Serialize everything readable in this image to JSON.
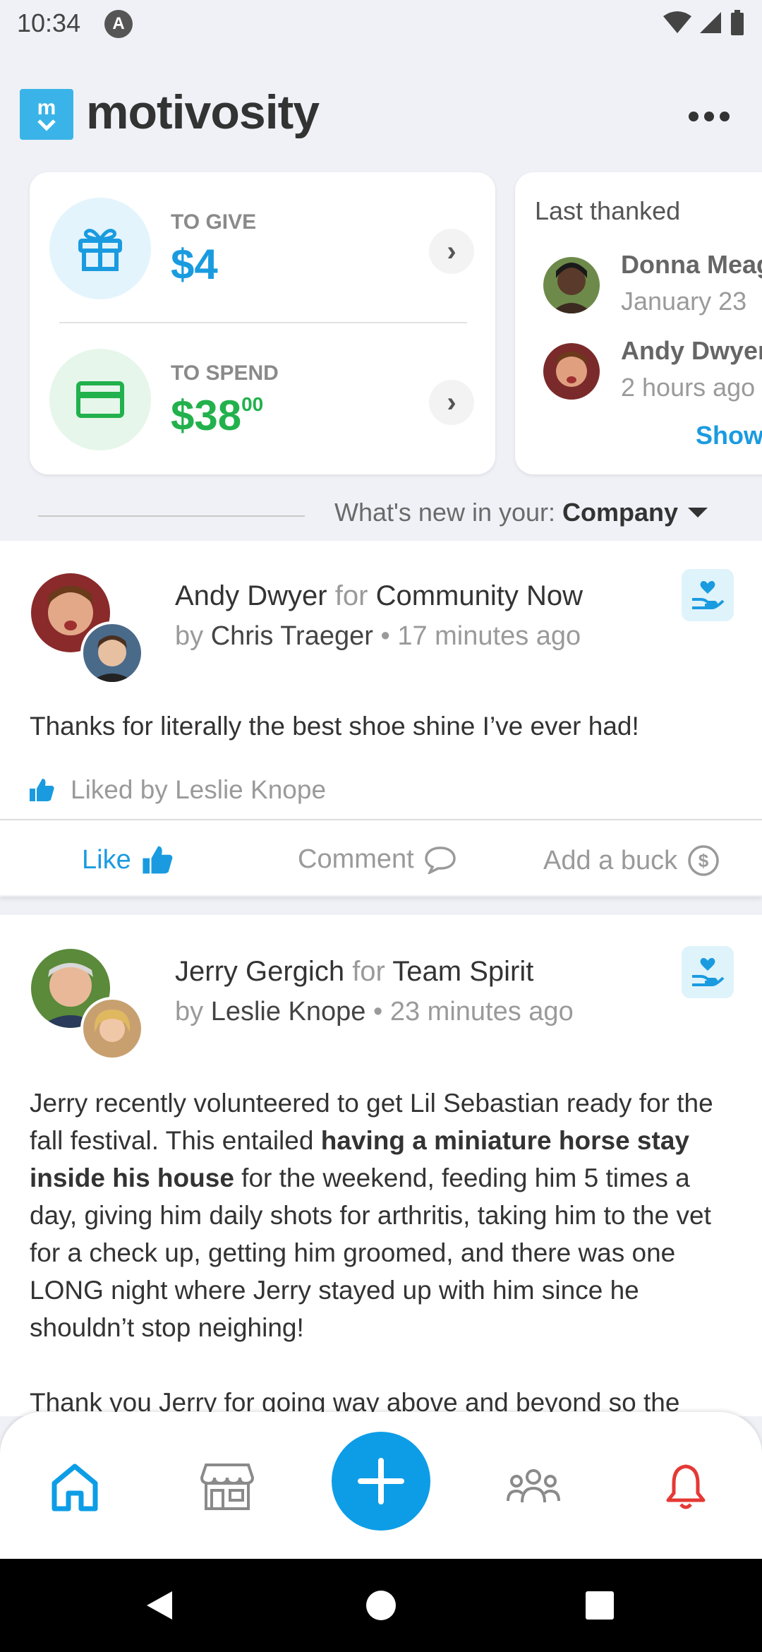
{
  "status": {
    "time": "10:34",
    "app_indicator": "A"
  },
  "app": {
    "logo_mark": "m",
    "logo_text": "motivosity"
  },
  "wallet": {
    "give_label": "TO GIVE",
    "give_amount": "$4",
    "spend_label": "TO SPEND",
    "spend_amount": "$38",
    "spend_cents": "00"
  },
  "last_thanked": {
    "title": "Last thanked",
    "people": [
      {
        "name": "Donna Meagle",
        "date": "January 23"
      },
      {
        "name": "Andy Dwyer",
        "date": "2 hours ago"
      }
    ],
    "show_label": "Show"
  },
  "feed_filter": {
    "prefix": "What's new in your:",
    "value": "Company"
  },
  "posts": [
    {
      "recipient": "Andy Dwyer",
      "for_word": "for",
      "value": "Community Now",
      "by_word": "by",
      "author": "Chris Traeger",
      "time": "• 17 minutes ago",
      "body": "Thanks for literally the best shoe shine I’ve ever had!",
      "liked_by": "Liked by Leslie Knope",
      "like_label": "Like",
      "comment_label": "Comment",
      "add_buck_label": "Add a buck"
    },
    {
      "recipient": "Jerry Gergich",
      "for_word": "for",
      "value": "Team Spirit",
      "by_word": "by",
      "author": "Leslie Knope",
      "time": "• 23 minutes ago",
      "body_1": "Jerry recently volunteered to get Lil Sebastian ready for the fall festival. This entailed ",
      "body_bold": "having a miniature horse stay inside his house",
      "body_2": " for the weekend, feeding him 5 times a day, giving him daily shots for arthritis, taking him to the vet for a check up, getting him groomed, and there was one LONG night where Jerry stayed up with him since he shouldn’t stop neighing!",
      "body_3": "Thank you Jerry for going way above and beyond so the"
    }
  ],
  "colors": {
    "accent": "#0d9de7",
    "give": "#1a9be0",
    "spend": "#22b14c",
    "alert": "#e53935"
  }
}
